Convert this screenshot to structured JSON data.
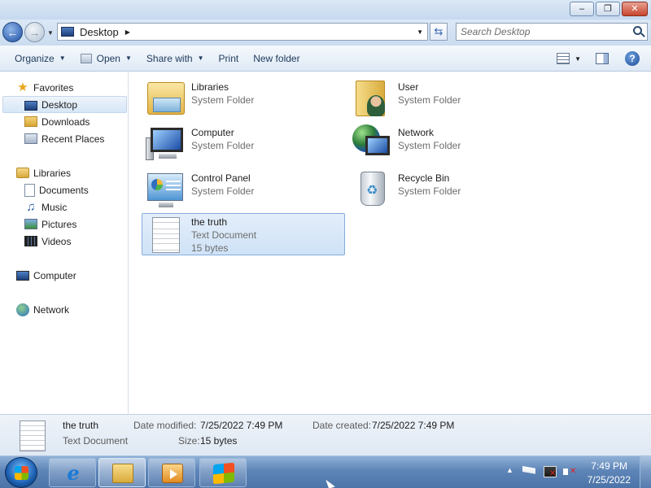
{
  "window": {
    "controls": {
      "minimize": "–",
      "maximize": "❐",
      "close": "✕"
    }
  },
  "nav": {
    "back_glyph": "←",
    "forward_glyph": "→",
    "address": {
      "crumb": "Desktop",
      "separator": "▶",
      "dropdown": "▼"
    },
    "refresh_glyph": "⇆",
    "search": {
      "placeholder": "Search Desktop"
    }
  },
  "toolbar": {
    "organize": "Organize",
    "open": "Open",
    "share_with": "Share with",
    "print": "Print",
    "new_folder": "New folder",
    "dropdown": "▼",
    "help": "?"
  },
  "sidebar": {
    "favorites": {
      "label": "Favorites",
      "icon": "star-icon"
    },
    "favorite_items": [
      {
        "label": "Desktop",
        "icon": "desktop-icon",
        "selected": true
      },
      {
        "label": "Downloads",
        "icon": "downloads-folder-icon"
      },
      {
        "label": "Recent Places",
        "icon": "recent-places-icon"
      }
    ],
    "libraries": {
      "label": "Libraries",
      "icon": "libraries-icon"
    },
    "library_items": [
      {
        "label": "Documents",
        "icon": "documents-icon"
      },
      {
        "label": "Music",
        "icon": "music-icon"
      },
      {
        "label": "Pictures",
        "icon": "pictures-icon"
      },
      {
        "label": "Videos",
        "icon": "videos-icon"
      }
    ],
    "computer": {
      "label": "Computer",
      "icon": "computer-icon"
    },
    "network": {
      "label": "Network",
      "icon": "network-icon"
    }
  },
  "content": {
    "items": [
      {
        "name": "Libraries",
        "type": "System Folder",
        "icon": "libraries-folder-icon"
      },
      {
        "name": "User",
        "type": "System Folder",
        "icon": "user-folder-icon"
      },
      {
        "name": "Computer",
        "type": "System Folder",
        "icon": "computer-icon"
      },
      {
        "name": "Network",
        "type": "System Folder",
        "icon": "network-icon"
      },
      {
        "name": "Control Panel",
        "type": "System Folder",
        "icon": "control-panel-icon"
      },
      {
        "name": "Recycle Bin",
        "type": "System Folder",
        "icon": "recycle-bin-icon"
      },
      {
        "name": "the truth",
        "type": "Text Document",
        "size": "15 bytes",
        "icon": "text-document-icon",
        "selected": true
      }
    ]
  },
  "details": {
    "name": "the truth",
    "type": "Text Document",
    "date_modified_label": "Date modified:",
    "date_modified": "7/25/2022 7:49 PM",
    "size_label": "Size:",
    "size": "15 bytes",
    "date_created_label": "Date created:",
    "date_created": "7/25/2022 7:49 PM"
  },
  "taskbar": {
    "buttons": [
      {
        "icon": "internet-explorer-icon",
        "glyph": "e"
      },
      {
        "icon": "windows-explorer-icon",
        "active": true
      },
      {
        "icon": "media-player-icon"
      },
      {
        "icon": "windows-logo-icon"
      }
    ],
    "tray": {
      "show_hidden": "▲"
    },
    "clock": {
      "time": "7:49 PM",
      "date": "7/25/2022"
    }
  },
  "colors": {
    "selection": "#cfe2f7",
    "taskbar": "#5e85b8",
    "accent": "#1e395b"
  }
}
